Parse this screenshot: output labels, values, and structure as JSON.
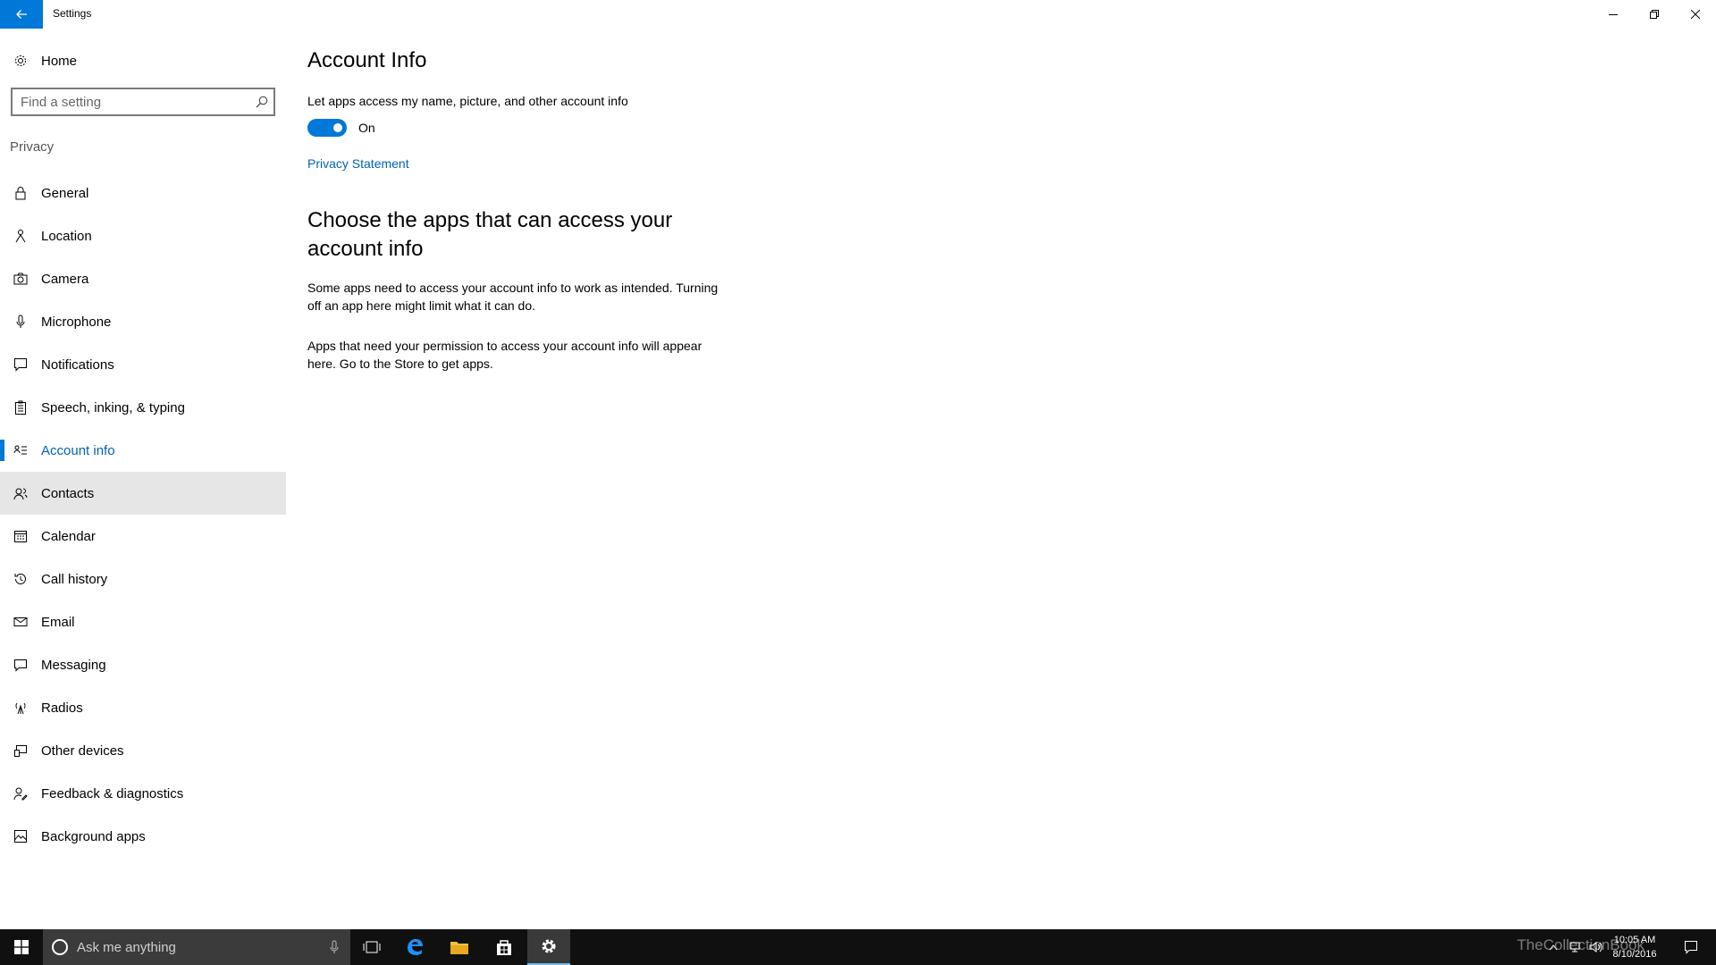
{
  "window": {
    "title": "Settings"
  },
  "sidebar": {
    "home_label": "Home",
    "search_placeholder": "Find a setting",
    "section": "Privacy",
    "items": [
      {
        "label": "General",
        "icon": "lock-icon"
      },
      {
        "label": "Location",
        "icon": "location-person-icon"
      },
      {
        "label": "Camera",
        "icon": "camera-icon"
      },
      {
        "label": "Microphone",
        "icon": "microphone-icon"
      },
      {
        "label": "Notifications",
        "icon": "notification-icon"
      },
      {
        "label": "Speech, inking, & typing",
        "icon": "clipboard-icon"
      },
      {
        "label": "Account info",
        "icon": "account-card-icon"
      },
      {
        "label": "Contacts",
        "icon": "contacts-icon"
      },
      {
        "label": "Calendar",
        "icon": "calendar-icon"
      },
      {
        "label": "Call history",
        "icon": "history-icon"
      },
      {
        "label": "Email",
        "icon": "mail-icon"
      },
      {
        "label": "Messaging",
        "icon": "message-icon"
      },
      {
        "label": "Radios",
        "icon": "antenna-icon"
      },
      {
        "label": "Other devices",
        "icon": "devices-icon"
      },
      {
        "label": "Feedback & diagnostics",
        "icon": "feedback-icon"
      },
      {
        "label": "Background apps",
        "icon": "background-apps-icon"
      }
    ],
    "selected_index": 6,
    "hover_index": 7
  },
  "content": {
    "title": "Account Info",
    "toggle_description": "Let apps access my name, picture, and other account info",
    "toggle_state": "On",
    "privacy_link": "Privacy Statement",
    "section_title": "Choose the apps that can access your account info",
    "paragraph1": "Some apps need to access your account info to work as intended. Turning off an app here might limit what it can do.",
    "paragraph2": "Apps that need your permission to access your account info will appear here. Go to the Store to get apps."
  },
  "taskbar": {
    "search_placeholder": "Ask me anything",
    "time": "10:05 AM",
    "date": "8/10/2016",
    "watermark": "TheCollectionBook"
  },
  "colors": {
    "accent": "#0078d7",
    "link": "#0063b1",
    "taskbar": "#101010"
  }
}
